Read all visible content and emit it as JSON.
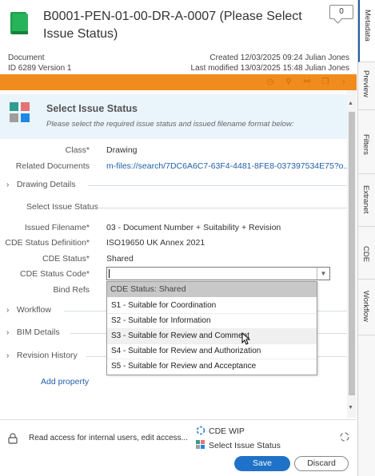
{
  "header": {
    "title": "B0001-PEN-01-00-DR-A-0007 (Please Select Issue Status)",
    "comment_count": "0",
    "object_type": "Document",
    "id_version": "ID 6289  Version 1",
    "created": "Created 12/03/2025 09:24 Julian Jones",
    "modified": "Last modified 13/03/2025 15:48 Julian Jones"
  },
  "banner": {
    "title": "Select Issue Status",
    "subtitle": "Please select the required issue status and issued filename format below:"
  },
  "properties": {
    "class_label": "Class*",
    "class_value": "Drawing",
    "related_label": "Related Documents",
    "related_value": "m-files://search/7DC6A6C7-63F4-4481-8FE8-037397534E75?o...",
    "issued_filename_label": "Issued Filename*",
    "issued_filename_value": "03 - Document Number + Suitability + Revision",
    "cde_def_label": "CDE Status Definition*",
    "cde_def_value": "ISO19650 UK Annex 2021",
    "cde_status_label": "CDE Status*",
    "cde_status_value": "Shared",
    "cde_code_label": "CDE Status Code*",
    "cde_code_value": "",
    "bind_refs_label": "Bind Refs"
  },
  "sections": {
    "drawing_details": "Drawing Details",
    "select_issue_status": "Select Issue Status",
    "workflow": "Workflow",
    "bim_details": "BIM Details",
    "revision_history": "Revision History"
  },
  "dropdown": {
    "header": "CDE Status: Shared",
    "items": [
      "S1 - Suitable for Coordination",
      "S2 - Suitable for Information",
      "S3 - Suitable for Review and Comment",
      "S4 - Suitable for Review and Authorization",
      "S5 - Suitable for Review and Acceptance"
    ],
    "hover_index": 2
  },
  "add_property": "Add property",
  "right_tabs": [
    "Metadata",
    "Preview",
    "Filters",
    "Extranet",
    "CDE",
    "Workflow"
  ],
  "footer": {
    "access": "Read access for internal users, edit access...",
    "workflow": "CDE WIP",
    "state": "Select Issue Status",
    "save": "Save",
    "discard": "Discard"
  },
  "colors": {
    "orange_bar": "#f08c1e",
    "link": "#1f5fa8",
    "save_button": "#1f72c8",
    "banner_bg": "#eaf4fb"
  }
}
